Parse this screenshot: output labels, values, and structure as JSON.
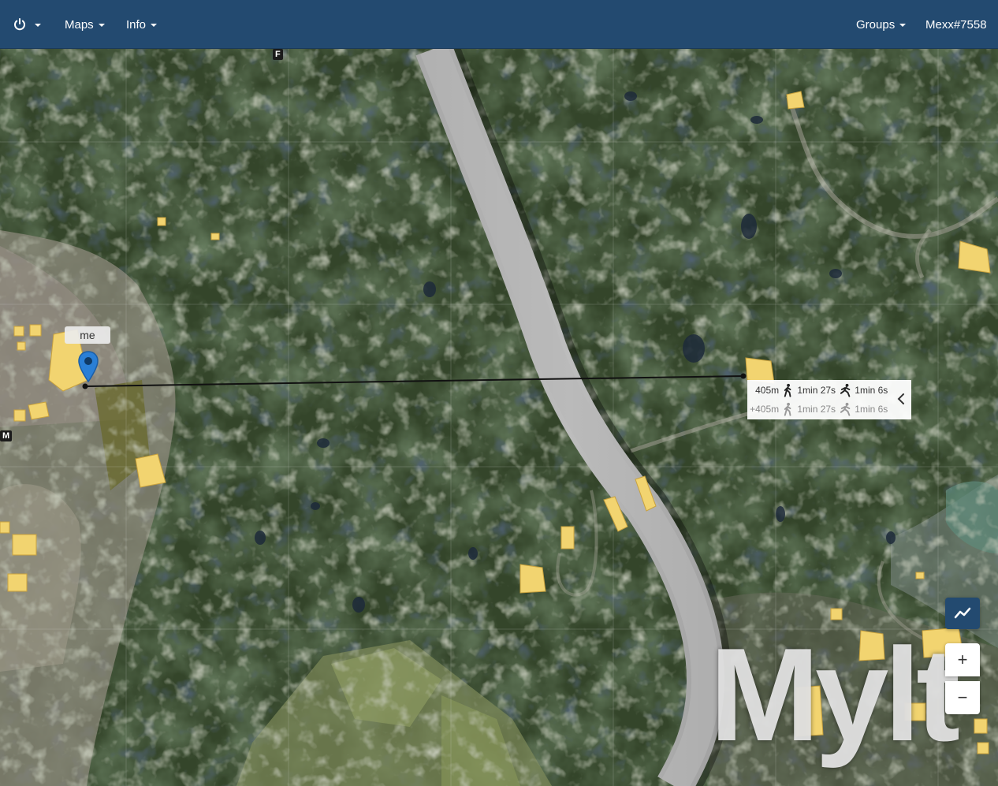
{
  "navbar": {
    "power_icon": "power-icon",
    "maps_label": "Maps",
    "info_label": "Info",
    "groups_label": "Groups",
    "user_label": "Mexx#7558"
  },
  "map": {
    "grid_labels": {
      "top": "F",
      "left": "M"
    },
    "player_label": "me",
    "city_label": "Mylt",
    "measurement": {
      "distance": "405m",
      "walk_time": "1min 27s",
      "run_time": "1min 6s",
      "total_distance": "+405m",
      "total_walk_time": "1min 27s",
      "total_run_time": "1min 6s"
    },
    "controls": {
      "measure_icon": "measure-icon",
      "zoom_in": "+",
      "zoom_out": "−"
    }
  }
}
